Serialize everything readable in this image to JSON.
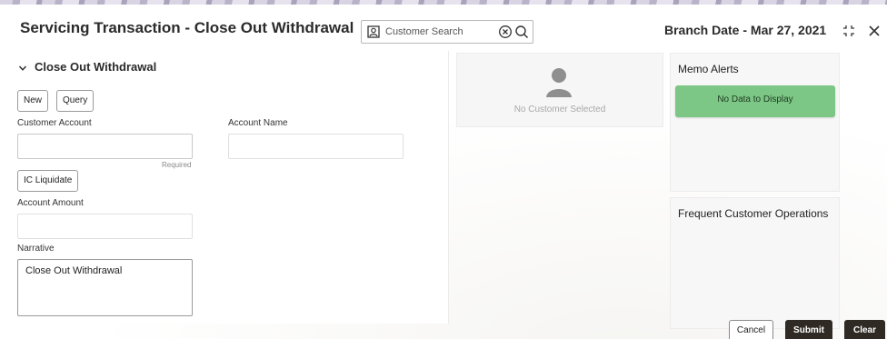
{
  "header": {
    "title": "Servicing Transaction - Close Out Withdrawal",
    "branch_date": "Branch Date - Mar 27, 2021"
  },
  "search": {
    "placeholder": "Customer Search",
    "value": ""
  },
  "section": {
    "title": "Close Out Withdrawal",
    "new_label": "New",
    "query_label": "Query"
  },
  "form": {
    "customer_account_label": "Customer Account",
    "customer_account_value": "",
    "required_note": "Required",
    "account_name_label": "Account Name",
    "account_name_value": "",
    "ic_liquidate_label": "IC Liquidate",
    "account_amount_label": "Account Amount",
    "account_amount_value": "",
    "narrative_label": "Narrative",
    "narrative_value": "Close Out Withdrawal"
  },
  "customer_card": {
    "empty_text": "No Customer Selected"
  },
  "memo_alerts": {
    "title": "Memo Alerts",
    "empty_text": "No Data to Display",
    "color": "#7cc785"
  },
  "frequent_ops": {
    "title": "Frequent Customer Operations"
  },
  "footer": {
    "cancel_label": "Cancel",
    "submit_label": "Submit",
    "clear_label": "Clear"
  },
  "icons": {
    "search_prefix": "person-card-icon",
    "clear": "clear-circle-icon",
    "search": "search-icon",
    "shrink": "shrink-icon",
    "close": "close-icon",
    "section_toggle": "chevron-down-icon",
    "avatar": "person-avatar-icon"
  },
  "colors": {
    "primary_button": "#2f2a24",
    "memo_green": "#7cc785"
  }
}
